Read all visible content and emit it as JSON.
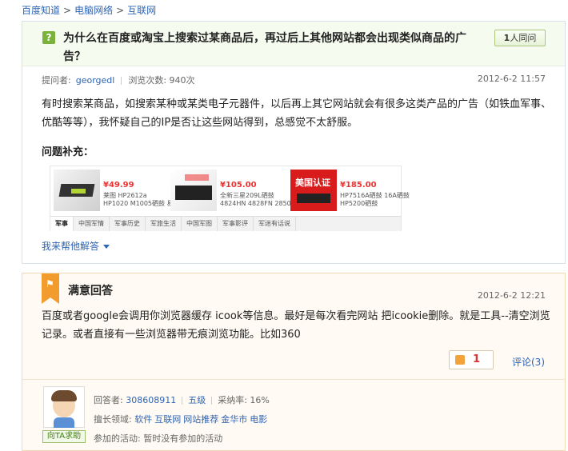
{
  "breadcrumb": [
    "百度知道",
    "电脑网络",
    "互联网"
  ],
  "question": {
    "title": "为什么在百度或淘宝上搜索过某商品后，再过后上其他网站都会出现类似商品的广告？",
    "same_count": "1",
    "same_label": "人同问",
    "asker_label": "提问者:",
    "asker": "georgedl",
    "views_label": "浏览次数:",
    "views": "940次",
    "date": "2012-6-2 11:57",
    "body": "有时搜索某商品，如搜索某种或某类电子元器件，以后再上其它网站就会有很多这类产品的广告（如铁血军事、优酷等等），我怀疑自己的IP是否让这些网站得到，总感觉不太舒服。",
    "supplement_title": "问题补充：",
    "help_link": "我来帮他解答"
  },
  "ad": {
    "products": [
      {
        "price": "¥49.99",
        "desc1": "莱图 HP2612a",
        "desc2": "HP1020 M1005硒鼓 易"
      },
      {
        "price": "¥105.00",
        "desc1": "全新三星209L硒鼓",
        "desc2": "4824HN 4828FN 2850"
      },
      {
        "price": "¥185.00",
        "desc1": "HP7516A硒鼓 16A硒鼓",
        "desc2": "HP5200硒鼓"
      }
    ],
    "badge_text": "美国认证",
    "tabs": [
      "军事",
      "中国军情",
      "军事历史",
      "军旅生活",
      "中国军图",
      "军事影评",
      "军迷有话说"
    ]
  },
  "answer": {
    "title": "满意回答",
    "date": "2012-6-2 12:21",
    "body": "百度或者google会调用你浏览器缓存 icook等信息。最好是每次看完网站 把icookie删除。就是工具--清空浏览记录。或者直接有一些浏览器带无痕浏览功能。比如360",
    "likes": "1",
    "comment": "评论(3)",
    "answerer_label": "回答者:",
    "answerer": "308608911",
    "level": "五级",
    "accept_rate": "采纳率: 16%",
    "expertise_label": "擅长领域:",
    "expertise": [
      "软件",
      "互联网",
      "网站推荐",
      "金华市",
      "电影"
    ],
    "activity_label": "参加的活动:",
    "activity": "暂时没有参加的活动",
    "help_btn": "向TA求助"
  }
}
